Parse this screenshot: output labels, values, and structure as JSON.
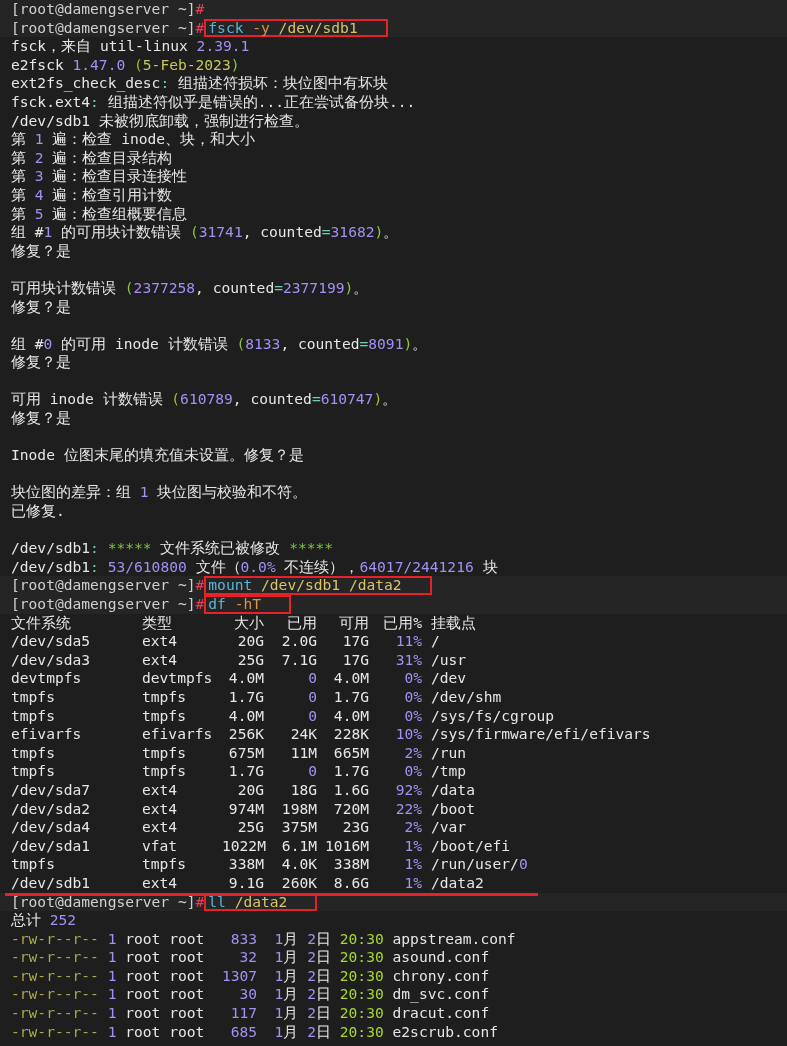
{
  "lines": [
    {
      "kind": "prompt",
      "prompt": "[root@damengserver ~]",
      "symbol": "#"
    },
    {
      "kind": "prompt",
      "prompt": "[root@damengserver ~]",
      "symbol": "#",
      "boxed": true,
      "command": [
        {
          "text": "fsck",
          "kind": "cmd"
        },
        {
          "text": " -y",
          "kind": "opt"
        },
        {
          "text": " /dev/sdb1",
          "kind": "path"
        }
      ]
    },
    {
      "kind": "output",
      "segments": [
        {
          "text": "fsck，来自 util-linux "
        },
        {
          "text": "2.39.1",
          "kind": "num"
        }
      ]
    },
    {
      "kind": "output",
      "segments": [
        {
          "text": "e2fsck "
        },
        {
          "text": "1.47.0",
          "kind": "num"
        },
        {
          "text": " (",
          "kind": "paren"
        },
        {
          "text": "5-Feb-2023",
          "kind": "date"
        },
        {
          "text": ")",
          "kind": "paren"
        }
      ]
    },
    {
      "kind": "output",
      "segments": [
        {
          "text": "ext2fs_check_desc"
        },
        {
          "text": ":",
          "kind": "sep"
        },
        {
          "text": " 组描述符损坏：块位图中有坏块"
        }
      ]
    },
    {
      "kind": "output",
      "segments": [
        {
          "text": "fsck.ext4"
        },
        {
          "text": ":",
          "kind": "sep"
        },
        {
          "text": " 组描述符似乎是错误的...正在尝试备份块..."
        }
      ]
    },
    {
      "kind": "output",
      "segments": [
        {
          "text": "/dev/sdb1 未被彻底卸载，强制进行检查。"
        }
      ]
    },
    {
      "kind": "output",
      "segments": [
        {
          "text": "第 "
        },
        {
          "text": "1",
          "kind": "num"
        },
        {
          "text": " 遍：检查 inode、块，和大小"
        }
      ]
    },
    {
      "kind": "output",
      "segments": [
        {
          "text": "第 "
        },
        {
          "text": "2",
          "kind": "num"
        },
        {
          "text": " 遍：检查目录结构"
        }
      ]
    },
    {
      "kind": "output",
      "segments": [
        {
          "text": "第 "
        },
        {
          "text": "3",
          "kind": "num"
        },
        {
          "text": " 遍：检查目录连接性"
        }
      ]
    },
    {
      "kind": "output",
      "segments": [
        {
          "text": "第 "
        },
        {
          "text": "4",
          "kind": "num"
        },
        {
          "text": " 遍：检查引用计数"
        }
      ]
    },
    {
      "kind": "output",
      "segments": [
        {
          "text": "第 "
        },
        {
          "text": "5",
          "kind": "num"
        },
        {
          "text": " 遍：检查组概要信息"
        }
      ]
    },
    {
      "kind": "output",
      "segments": [
        {
          "text": "组 #"
        },
        {
          "text": "1",
          "kind": "num"
        },
        {
          "text": " 的可用块计数错误 "
        },
        {
          "text": "(",
          "kind": "paren"
        },
        {
          "text": "31741",
          "kind": "num"
        },
        {
          "text": ", counted"
        },
        {
          "text": "=",
          "kind": "sep"
        },
        {
          "text": "31682",
          "kind": "num"
        },
        {
          "text": ")",
          "kind": "paren"
        },
        {
          "text": "。"
        }
      ]
    },
    {
      "kind": "output",
      "segments": [
        {
          "text": "修复？是"
        }
      ]
    },
    {
      "kind": "blank"
    },
    {
      "kind": "output",
      "segments": [
        {
          "text": "可用块计数错误 "
        },
        {
          "text": "(",
          "kind": "paren"
        },
        {
          "text": "2377258",
          "kind": "num"
        },
        {
          "text": ", counted"
        },
        {
          "text": "=",
          "kind": "sep"
        },
        {
          "text": "2377199",
          "kind": "num"
        },
        {
          "text": ")",
          "kind": "paren"
        },
        {
          "text": "。"
        }
      ]
    },
    {
      "kind": "output",
      "segments": [
        {
          "text": "修复？是"
        }
      ]
    },
    {
      "kind": "blank"
    },
    {
      "kind": "output",
      "segments": [
        {
          "text": "组 #"
        },
        {
          "text": "0",
          "kind": "num"
        },
        {
          "text": " 的可用 inode 计数错误 "
        },
        {
          "text": "(",
          "kind": "paren"
        },
        {
          "text": "8133",
          "kind": "num"
        },
        {
          "text": ", counted"
        },
        {
          "text": "=",
          "kind": "sep"
        },
        {
          "text": "8091",
          "kind": "num"
        },
        {
          "text": ")",
          "kind": "paren"
        },
        {
          "text": "。"
        }
      ]
    },
    {
      "kind": "output",
      "segments": [
        {
          "text": "修复？是"
        }
      ]
    },
    {
      "kind": "blank"
    },
    {
      "kind": "output",
      "segments": [
        {
          "text": "可用 inode 计数错误 "
        },
        {
          "text": "(",
          "kind": "paren"
        },
        {
          "text": "610789",
          "kind": "num"
        },
        {
          "text": ", counted"
        },
        {
          "text": "=",
          "kind": "sep"
        },
        {
          "text": "610747",
          "kind": "num"
        },
        {
          "text": ")",
          "kind": "paren"
        },
        {
          "text": "。"
        }
      ]
    },
    {
      "kind": "output",
      "segments": [
        {
          "text": "修复？是"
        }
      ]
    },
    {
      "kind": "blank"
    },
    {
      "kind": "output",
      "segments": [
        {
          "text": "Inode 位图末尾的填充值未设置。修复？是"
        }
      ]
    },
    {
      "kind": "blank"
    },
    {
      "kind": "output",
      "segments": [
        {
          "text": "块位图的差异：组 "
        },
        {
          "text": "1",
          "kind": "num"
        },
        {
          "text": " 块位图与校验和不符。"
        }
      ]
    },
    {
      "kind": "output",
      "segments": [
        {
          "text": "已修复."
        }
      ]
    },
    {
      "kind": "blank"
    },
    {
      "kind": "output",
      "segments": [
        {
          "text": "/dev/sdb1"
        },
        {
          "text": ":",
          "kind": "sep"
        },
        {
          "text": " *****",
          "kind": "stars"
        },
        {
          "text": " 文件系统已被修改 "
        },
        {
          "text": "*****",
          "kind": "stars"
        }
      ]
    },
    {
      "kind": "output",
      "segments": [
        {
          "text": "/dev/sdb1"
        },
        {
          "text": ":",
          "kind": "sep"
        },
        {
          "text": " 53/610800",
          "kind": "num"
        },
        {
          "text": " 文件（"
        },
        {
          "text": "0.0%",
          "kind": "num"
        },
        {
          "text": " 不连续），"
        },
        {
          "text": "64017/2441216",
          "kind": "num"
        },
        {
          "text": " 块"
        }
      ]
    },
    {
      "kind": "prompt",
      "prompt": "[root@damengserver ~]",
      "symbol": "#",
      "boxed": true,
      "command": [
        {
          "text": "mount",
          "kind": "cmd"
        },
        {
          "text": " /dev/sdb1 /data2",
          "kind": "path"
        }
      ]
    },
    {
      "kind": "prompt",
      "prompt": "[root@damengserver ~]",
      "symbol": "#",
      "boxed": true,
      "command": [
        {
          "text": "df",
          "kind": "cmd"
        },
        {
          "text": " -hT",
          "kind": "opt"
        }
      ]
    },
    {
      "kind": "table",
      "underlined": true,
      "columns": [
        "文件系统",
        "类型",
        "大小",
        "已用",
        "可用",
        "已用%",
        "挂载点"
      ],
      "rows": [
        [
          "/dev/sda5",
          "ext4",
          "20G",
          "2.0G",
          "17G",
          [
            {
              "text": "11%",
              "kind": "num"
            }
          ],
          "/"
        ],
        [
          "/dev/sda3",
          "ext4",
          "25G",
          "7.1G",
          "17G",
          [
            {
              "text": "31%",
              "kind": "num"
            }
          ],
          "/usr"
        ],
        [
          "devtmpfs",
          "devtmpfs",
          "4.0M",
          [
            {
              "text": "0",
              "kind": "num"
            }
          ],
          "4.0M",
          [
            {
              "text": "0%",
              "kind": "num"
            }
          ],
          "/dev"
        ],
        [
          "tmpfs",
          "tmpfs",
          "1.7G",
          [
            {
              "text": "0",
              "kind": "num"
            }
          ],
          "1.7G",
          [
            {
              "text": "0%",
              "kind": "num"
            }
          ],
          "/dev/shm"
        ],
        [
          "tmpfs",
          "tmpfs",
          "4.0M",
          [
            {
              "text": "0",
              "kind": "num"
            }
          ],
          "4.0M",
          [
            {
              "text": "0%",
              "kind": "num"
            }
          ],
          "/sys/fs/cgroup"
        ],
        [
          "efivarfs",
          "efivarfs",
          "256K",
          "24K",
          "228K",
          [
            {
              "text": "10%",
              "kind": "num"
            }
          ],
          "/sys/firmware/efi/efivars"
        ],
        [
          "tmpfs",
          "tmpfs",
          "675M",
          "11M",
          "665M",
          [
            {
              "text": "2%",
              "kind": "num"
            }
          ],
          "/run"
        ],
        [
          "tmpfs",
          "tmpfs",
          "1.7G",
          [
            {
              "text": "0",
              "kind": "num"
            }
          ],
          "1.7G",
          [
            {
              "text": "0%",
              "kind": "num"
            }
          ],
          "/tmp"
        ],
        [
          "/dev/sda7",
          "ext4",
          "20G",
          "18G",
          "1.6G",
          [
            {
              "text": "92%",
              "kind": "num"
            }
          ],
          "/data"
        ],
        [
          "/dev/sda2",
          "ext4",
          "974M",
          "198M",
          "720M",
          [
            {
              "text": "22%",
              "kind": "num"
            }
          ],
          "/boot"
        ],
        [
          "/dev/sda4",
          "ext4",
          "25G",
          "375M",
          "23G",
          [
            {
              "text": "2%",
              "kind": "num"
            }
          ],
          "/var"
        ],
        [
          "/dev/sda1",
          "vfat",
          "1022M",
          "6.1M",
          "1016M",
          [
            {
              "text": "1%",
              "kind": "num"
            }
          ],
          "/boot/efi"
        ],
        [
          "tmpfs",
          "tmpfs",
          "338M",
          "4.0K",
          "338M",
          [
            {
              "text": "1%",
              "kind": "num"
            }
          ],
          [
            {
              "text": "/run/user/"
            },
            {
              "text": "0",
              "kind": "num"
            }
          ]
        ],
        [
          "/dev/sdb1",
          "ext4",
          "9.1G",
          "260K",
          "8.6G",
          [
            {
              "text": "1%",
              "kind": "num"
            }
          ],
          "/data2"
        ]
      ]
    },
    {
      "kind": "prompt",
      "prompt": "[root@damengserver ~]",
      "symbol": "#",
      "boxed": true,
      "command": [
        {
          "text": "ll",
          "kind": "cmd"
        },
        {
          "text": " /data2",
          "kind": "path"
        }
      ]
    },
    {
      "kind": "output",
      "segments": [
        {
          "text": "总计 "
        },
        {
          "text": "252",
          "kind": "num"
        }
      ]
    },
    {
      "kind": "output",
      "segments": [
        {
          "text": "-rw-r--r--",
          "kind": "perm"
        },
        {
          "text": " 1",
          "kind": "num"
        },
        {
          "text": " root root   "
        },
        {
          "text": "833",
          "kind": "num"
        },
        {
          "text": "  1",
          "kind": "num"
        },
        {
          "text": "月 "
        },
        {
          "text": "2",
          "kind": "num"
        },
        {
          "text": "日 "
        },
        {
          "text": "20:30",
          "kind": "time"
        },
        {
          "text": " appstream.conf"
        }
      ]
    },
    {
      "kind": "output",
      "segments": [
        {
          "text": "-rw-r--r--",
          "kind": "perm"
        },
        {
          "text": " 1",
          "kind": "num"
        },
        {
          "text": " root root    "
        },
        {
          "text": "32",
          "kind": "num"
        },
        {
          "text": "  1",
          "kind": "num"
        },
        {
          "text": "月 "
        },
        {
          "text": "2",
          "kind": "num"
        },
        {
          "text": "日 "
        },
        {
          "text": "20:30",
          "kind": "time"
        },
        {
          "text": " asound.conf"
        }
      ]
    },
    {
      "kind": "output",
      "segments": [
        {
          "text": "-rw-r--r--",
          "kind": "perm"
        },
        {
          "text": " 1",
          "kind": "num"
        },
        {
          "text": " root root  "
        },
        {
          "text": "1307",
          "kind": "num"
        },
        {
          "text": "  1",
          "kind": "num"
        },
        {
          "text": "月 "
        },
        {
          "text": "2",
          "kind": "num"
        },
        {
          "text": "日 "
        },
        {
          "text": "20:30",
          "kind": "time"
        },
        {
          "text": " chrony.conf"
        }
      ]
    },
    {
      "kind": "output",
      "segments": [
        {
          "text": "-rw-r--r--",
          "kind": "perm"
        },
        {
          "text": " 1",
          "kind": "num"
        },
        {
          "text": " root root    "
        },
        {
          "text": "30",
          "kind": "num"
        },
        {
          "text": "  1",
          "kind": "num"
        },
        {
          "text": "月 "
        },
        {
          "text": "2",
          "kind": "num"
        },
        {
          "text": "日 "
        },
        {
          "text": "20:30",
          "kind": "time"
        },
        {
          "text": " dm_svc.conf"
        }
      ]
    },
    {
      "kind": "output",
      "segments": [
        {
          "text": "-rw-r--r--",
          "kind": "perm"
        },
        {
          "text": " 1",
          "kind": "num"
        },
        {
          "text": " root root   "
        },
        {
          "text": "117",
          "kind": "num"
        },
        {
          "text": "  1",
          "kind": "num"
        },
        {
          "text": "月 "
        },
        {
          "text": "2",
          "kind": "num"
        },
        {
          "text": "日 "
        },
        {
          "text": "20:30",
          "kind": "time"
        },
        {
          "text": " dracut.conf"
        }
      ]
    },
    {
      "kind": "output",
      "segments": [
        {
          "text": "-rw-r--r--",
          "kind": "perm"
        },
        {
          "text": " 1",
          "kind": "num"
        },
        {
          "text": " root root   "
        },
        {
          "text": "685",
          "kind": "num"
        },
        {
          "text": "  1",
          "kind": "num"
        },
        {
          "text": "月 "
        },
        {
          "text": "2",
          "kind": "num"
        },
        {
          "text": "日 "
        },
        {
          "text": "20:30",
          "kind": "time"
        },
        {
          "text": " e2scrub.conf"
        }
      ]
    }
  ]
}
